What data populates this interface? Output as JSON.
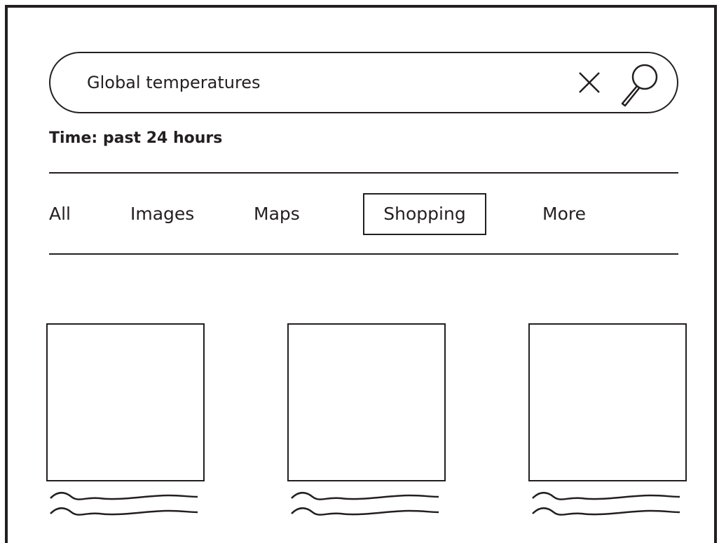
{
  "search": {
    "query": "Global temperatures",
    "clear_icon": "close-icon",
    "submit_icon": "search-icon"
  },
  "filter": {
    "time_label": "Time: past 24 hours"
  },
  "tabs": [
    {
      "label": "All",
      "active": false
    },
    {
      "label": "Images",
      "active": false
    },
    {
      "label": "Maps",
      "active": false
    },
    {
      "label": "Shopping",
      "active": true
    },
    {
      "label": "More",
      "active": false
    }
  ],
  "results": [
    {
      "caption": "placeholder-squiggle-text"
    },
    {
      "caption": "placeholder-squiggle-text"
    },
    {
      "caption": "placeholder-squiggle-text"
    }
  ],
  "colors": {
    "ink": "#231f20",
    "background": "#ffffff"
  }
}
